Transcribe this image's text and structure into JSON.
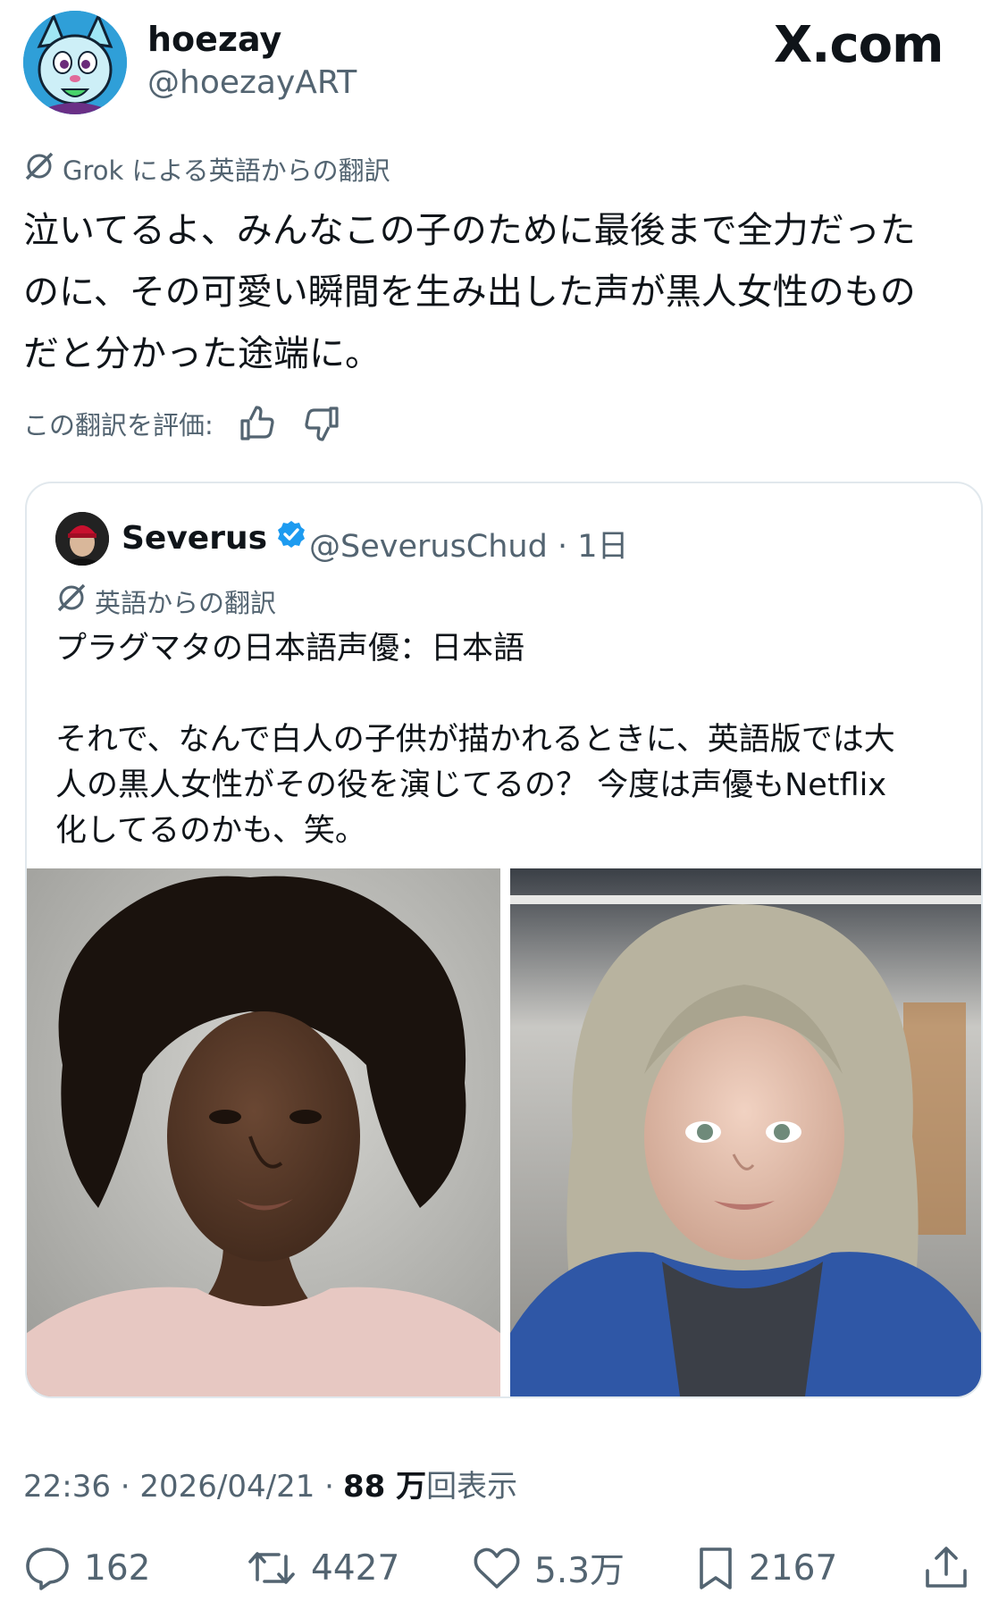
{
  "author": {
    "name": "hoezay",
    "handle": "@hoezayART"
  },
  "brand": {
    "logo_text": "X.com"
  },
  "translation": {
    "label": "Grok による英語からの翻訳",
    "lines": [
      "泣いてるよ、みんなこの子のために最後まで全力だった",
      "のに、その可愛い瞬間を生み出した声が黒人女性のもの",
      "だと分かった途端に。"
    ],
    "rate_label": "この翻訳を評価:"
  },
  "quote": {
    "name": "Severus",
    "handle_time": "@SeverusChud · 1日",
    "translation_label": "英語からの翻訳",
    "text": "プラグマタの日本語声優：日本語\n\nそれで、なんで白人の子供が描かれるときに、英語版では大\n人の黒人女性がその役を演じてるの？ 今度は声優もNetflix\n化してるのかも、笑。"
  },
  "meta": {
    "time_date": "22:36 · 2026/04/21 ·",
    "views_count": "88 万",
    "views_label": "回表示"
  },
  "actions": {
    "replies": "162",
    "reposts": "4427",
    "likes": "5.3万",
    "bookmarks": "2167"
  },
  "colors": {
    "text_primary": "#0f1419",
    "text_secondary": "#536471",
    "verified": "#1d9bf0",
    "border": "#e1e8ed"
  },
  "icons": [
    "grok-icon",
    "thumbs-up-icon",
    "thumbs-down-icon",
    "verified-badge-icon",
    "reply-icon",
    "repost-icon",
    "like-icon",
    "bookmark-icon",
    "share-icon"
  ]
}
